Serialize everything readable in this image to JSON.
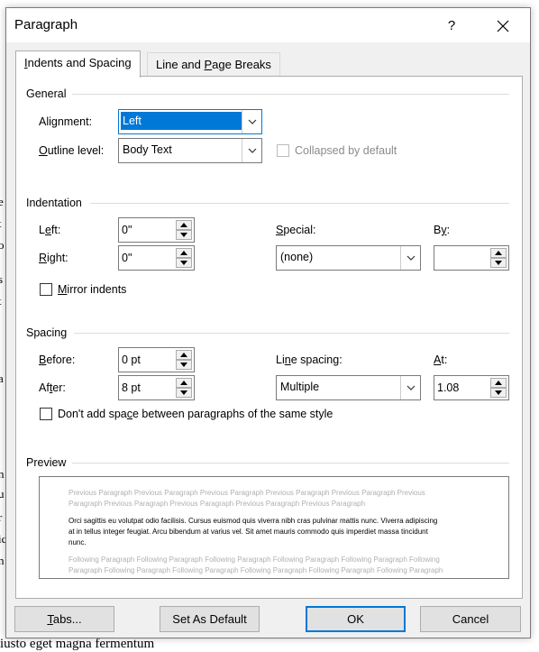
{
  "dialog": {
    "title": "Paragraph",
    "help": "?"
  },
  "tabs": [
    {
      "label_pre": "",
      "key": "I",
      "label_post": "ndents and Spacing",
      "active": true
    },
    {
      "label_pre": "Line and ",
      "key": "P",
      "label_post": "age Breaks",
      "active": false
    }
  ],
  "general": {
    "title": "General",
    "alignment": {
      "label_pre": "Ali",
      "key": "g",
      "label_post": "nment:",
      "value": "Left"
    },
    "outline_level": {
      "label_pre": "",
      "key": "O",
      "label_post": "utline level:",
      "value": "Body Text"
    },
    "collapsed": {
      "label": "Collapsed by default",
      "checked": false,
      "disabled": true
    }
  },
  "indentation": {
    "title": "Indentation",
    "left": {
      "label_pre": "L",
      "key": "e",
      "label_post": "ft:",
      "value": "0\""
    },
    "right": {
      "label_pre": "",
      "key": "R",
      "label_post": "ight:",
      "value": "0\""
    },
    "special": {
      "label_pre": "",
      "key": "S",
      "label_post": "pecial:",
      "value": "(none)"
    },
    "by": {
      "label_pre": "B",
      "key": "y",
      "label_post": ":",
      "value": ""
    },
    "mirror": {
      "label_pre": "",
      "key": "M",
      "label_post": "irror indents",
      "checked": false
    }
  },
  "spacing": {
    "title": "Spacing",
    "before": {
      "label_pre": "",
      "key": "B",
      "label_post": "efore:",
      "value": "0 pt"
    },
    "after": {
      "label_pre": "Af",
      "key": "t",
      "label_post": "er:",
      "value": "8 pt"
    },
    "line_spacing": {
      "label_pre": "Li",
      "key": "n",
      "label_post": "e spacing:",
      "value": "Multiple"
    },
    "at": {
      "label_pre": "",
      "key": "A",
      "label_post": "t:",
      "value": "1.08"
    },
    "dont_add": {
      "label_pre": "Don't add spa",
      "key": "c",
      "label_post": "e between paragraphs of the same style",
      "checked": false
    }
  },
  "preview": {
    "title": "Preview",
    "previous_line1": "Previous Paragraph Previous Paragraph Previous Paragraph Previous Paragraph Previous Paragraph Previous",
    "previous_line2": "Paragraph Previous Paragraph Previous Paragraph Previous Paragraph Previous Paragraph",
    "sample_line1": "Orci sagittis eu volutpat odio facilisis. Cursus euismod quis viverra nibh cras pulvinar mattis nunc. Viverra adipiscing",
    "sample_line2": "at in tellus integer feugiat. Arcu bibendum at varius vel. Sit amet mauris commodo quis imperdiet massa tincidunt",
    "sample_line3": "nunc.",
    "following_line1": "Following Paragraph Following Paragraph Following Paragraph Following Paragraph Following Paragraph Following",
    "following_line2": "Paragraph Following Paragraph Following Paragraph Following Paragraph Following Paragraph Following Paragraph"
  },
  "buttons": {
    "tabs": {
      "label_pre": "",
      "key": "T",
      "label_post": "abs..."
    },
    "set_default": {
      "label": "Set As Default"
    },
    "ok": {
      "label": "OK"
    },
    "cancel": {
      "label": "Cancel"
    }
  },
  "background": {
    "fragments": [
      "e",
      "t",
      "o",
      "s",
      "t",
      "a",
      "n",
      "u",
      "r",
      "ic",
      "n"
    ],
    "bottom_text": "iusto eget magna fermentum"
  },
  "colors": {
    "accent": "#0078d7",
    "dialog_bg": "#f0f0f0",
    "disabled_text": "#8b8b8b"
  }
}
